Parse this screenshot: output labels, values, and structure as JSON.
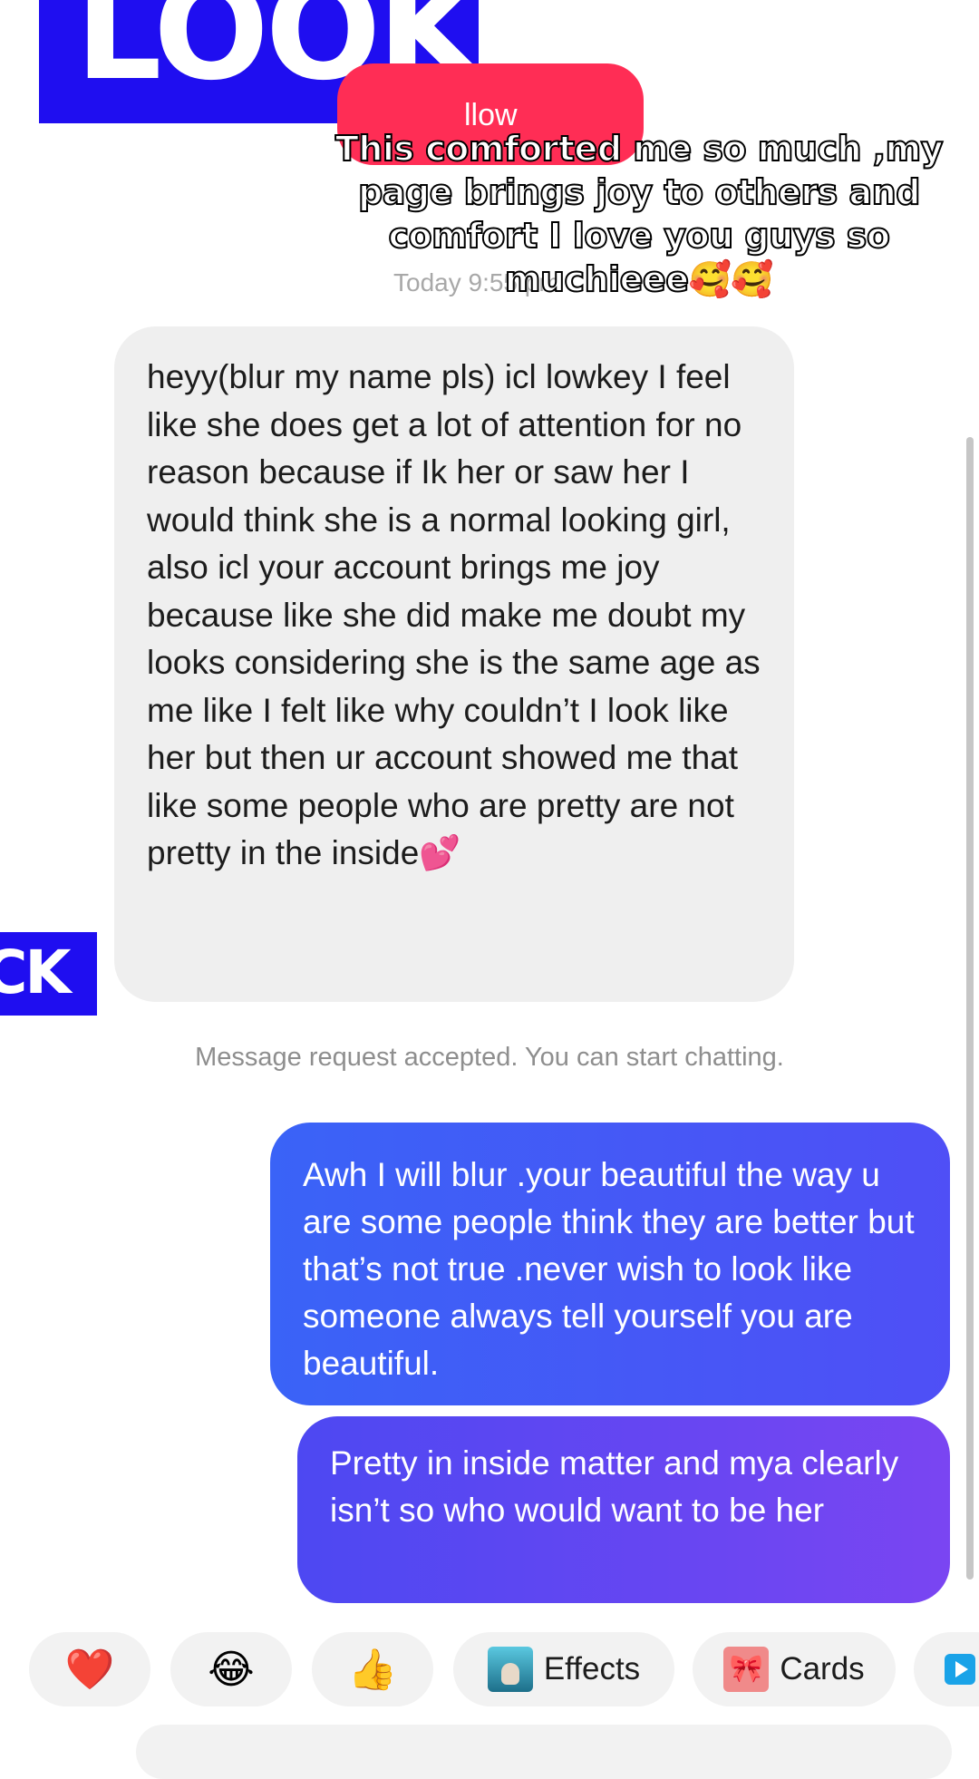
{
  "watermark": {
    "top": "LOOK",
    "side": "CK"
  },
  "header": {
    "follow_label": "llow",
    "timestamp": "Today 9:55 pm"
  },
  "caption": "This comforted me so much ,my page brings joy to others and comfort I love you guys so muchieee🥰🥰",
  "messages": {
    "incoming": "heyy(blur my name pls) icl lowkey I feel like she does get a lot of attention for no reason because if Ik her or saw her I would think she is a normal looking girl, also icl your account brings me joy because like she did make me doubt my looks considering she is the same age as me like I felt like why couldn’t I look like her but then ur account showed me that like some people who are pretty are not pretty in the inside💕",
    "system": "Message request accepted. You can start chatting.",
    "outgoing_1": "Awh I will blur .your beautiful the way u are some people think they are better but that’s not true .never wish to look like someone always tell yourself you are beautiful.",
    "outgoing_2": "Pretty in inside matter and mya clearly isn’t so who would want to be her"
  },
  "quick_reactions": {
    "heart": "❤️",
    "laugh": "😂",
    "thumbs": "👍",
    "effects_label": "Effects",
    "cards_label": "Cards",
    "cards_icon": "🎀"
  },
  "colors": {
    "follow": "#ff2d55",
    "outgoing_start": "#3a63f7",
    "outgoing_end": "#7a45f2",
    "watermark": "#1f0ef0"
  }
}
